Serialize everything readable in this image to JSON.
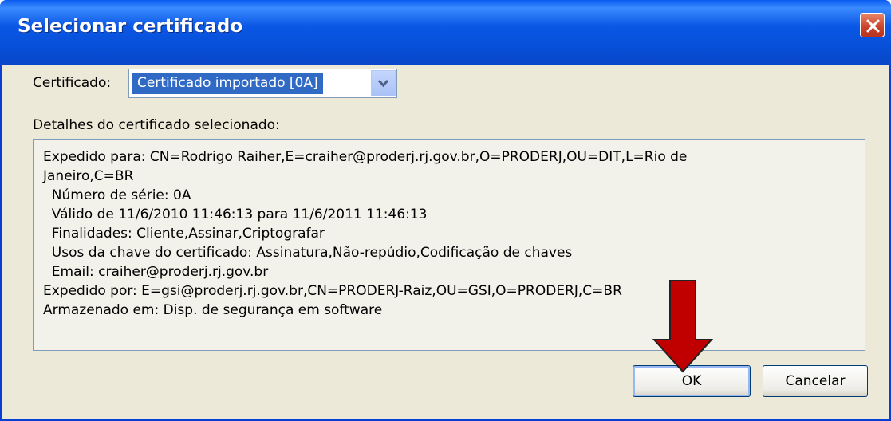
{
  "window": {
    "title": "Selecionar certificado"
  },
  "certificate": {
    "label": "Certificado:",
    "selected": "Certificado importado [0A]"
  },
  "details": {
    "label": "Detalhes do certificado selecionado:",
    "lines": [
      "Expedido para: CN=Rodrigo Raiher,E=craiher@proderj.rj.gov.br,O=PRODERJ,OU=DIT,L=Rio de",
      "Janeiro,C=BR",
      "  Número de série: 0A",
      "  Válido de 11/6/2010 11:46:13 para 11/6/2011 11:46:13",
      "  Finalidades: Cliente,Assinar,Criptografar",
      "  Usos da chave do certificado: Assinatura,Não-repúdio,Codificação de chaves",
      "  Email: craiher@proderj.rj.gov.br",
      "Expedido por: E=gsi@proderj.rj.gov.br,CN=PRODERJ-Raiz,OU=GSI,O=PRODERJ,C=BR",
      "Armazenado em: Disp. de segurança em software"
    ]
  },
  "buttons": {
    "ok": "OK",
    "cancel": "Cancelar"
  },
  "colors": {
    "titlebar": "#0a57e6",
    "selection": "#316ac5",
    "annotation_arrow": "#c00000"
  }
}
